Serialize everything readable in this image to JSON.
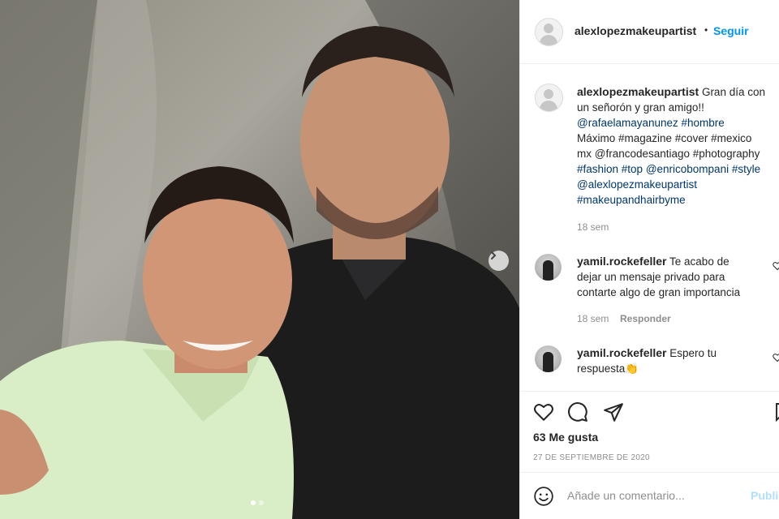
{
  "post": {
    "author": "alexlopezmakeupartist",
    "follow_label": "Seguir",
    "separator": "•",
    "caption_lines": [
      "Gran día con",
      "un señorón y gran amigo!!",
      "@rafaelamayanunez #hombre",
      "Máximo #magazine #cover #mexico",
      "mx @francodesantiago #photography",
      "#fashion #top @enricobompani #style",
      "@alexlopezmakeupartist",
      "#makeupandhairbyme"
    ],
    "caption_time": "18 sem",
    "likes": "63 Me gusta",
    "date": "27 DE SEPTIEMBRE DE 2020"
  },
  "comments": [
    {
      "user": "yamil.rockefeller",
      "lines": [
        "Te acabo de",
        "dejar un mensaje privado para",
        "contarte algo de gran importancia"
      ],
      "time": "18 sem",
      "reply_label": "Responder"
    },
    {
      "user": "yamil.rockefeller",
      "lines": [
        "Espero tu",
        "respuesta👏"
      ]
    }
  ],
  "add_comment": {
    "placeholder": "Añade un comentario...",
    "publish_label": "Publi"
  },
  "icons": {
    "like": "heart-icon",
    "comment": "comment-icon",
    "share": "send-icon",
    "emoji": "smiley-icon",
    "next": "chevron-right-icon"
  },
  "colors": {
    "link": "#00376b",
    "follow": "#0095f6",
    "muted": "#8e8e8e"
  }
}
